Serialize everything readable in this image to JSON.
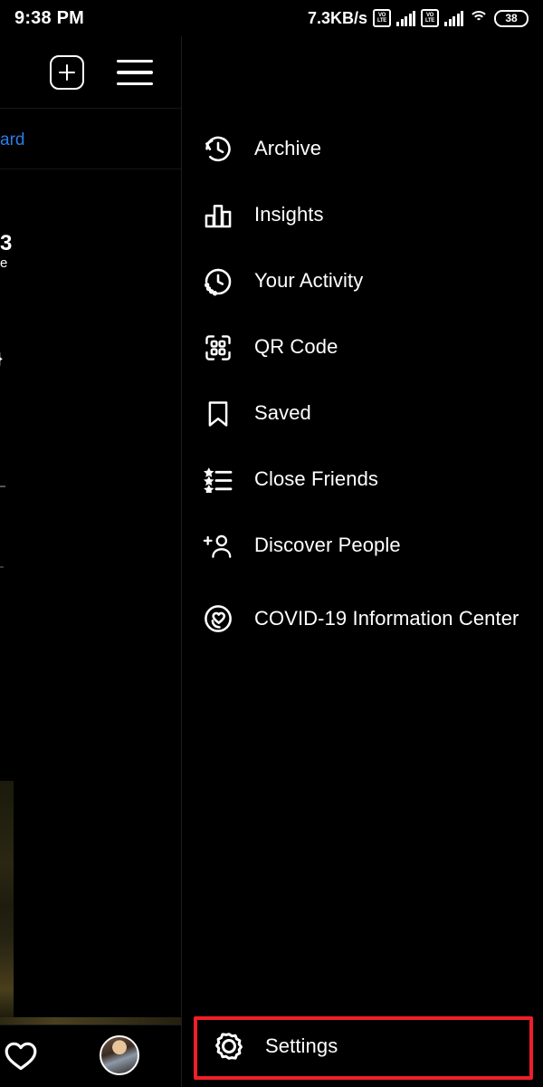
{
  "status_bar": {
    "time": "9:38 PM",
    "network_speed": "7.3KB/s",
    "volte_label_top": "VO",
    "volte_label_bottom": "LTE",
    "battery_level": "38",
    "icons": [
      "volte-icon",
      "signal-bars-icon",
      "volte-icon",
      "signal-bars-icon",
      "wifi-icon",
      "battery-icon"
    ]
  },
  "top_bar": {
    "add_post_icon": "plus-square-icon",
    "menu_icon": "hamburger-menu-icon"
  },
  "background": {
    "link_text": "ard",
    "count_text": "3",
    "sub_text": "e",
    "glyph_text": "}"
  },
  "drawer": {
    "items": [
      {
        "label": "Archive",
        "icon": "archive-clock-icon"
      },
      {
        "label": "Insights",
        "icon": "insights-bar-chart-icon"
      },
      {
        "label": "Your Activity",
        "icon": "activity-clock-icon"
      },
      {
        "label": "QR Code",
        "icon": "qr-code-icon"
      },
      {
        "label": "Saved",
        "icon": "bookmark-icon"
      },
      {
        "label": "Close Friends",
        "icon": "close-friends-star-list-icon"
      },
      {
        "label": "Discover People",
        "icon": "discover-people-person-plus-icon"
      },
      {
        "label": "COVID-19 Information Center",
        "icon": "covid-heart-circle-icon"
      }
    ],
    "settings": {
      "label": "Settings",
      "icon": "gear-icon",
      "highlight_color": "#ee1f28",
      "highlighted": "true"
    }
  },
  "bottom_nav": {
    "activity_icon": "heart-icon",
    "profile_icon": "avatar"
  },
  "colors": {
    "background": "#000000",
    "text": "#ffffff",
    "link": "#2b7de9",
    "highlight": "#ee1f28"
  }
}
